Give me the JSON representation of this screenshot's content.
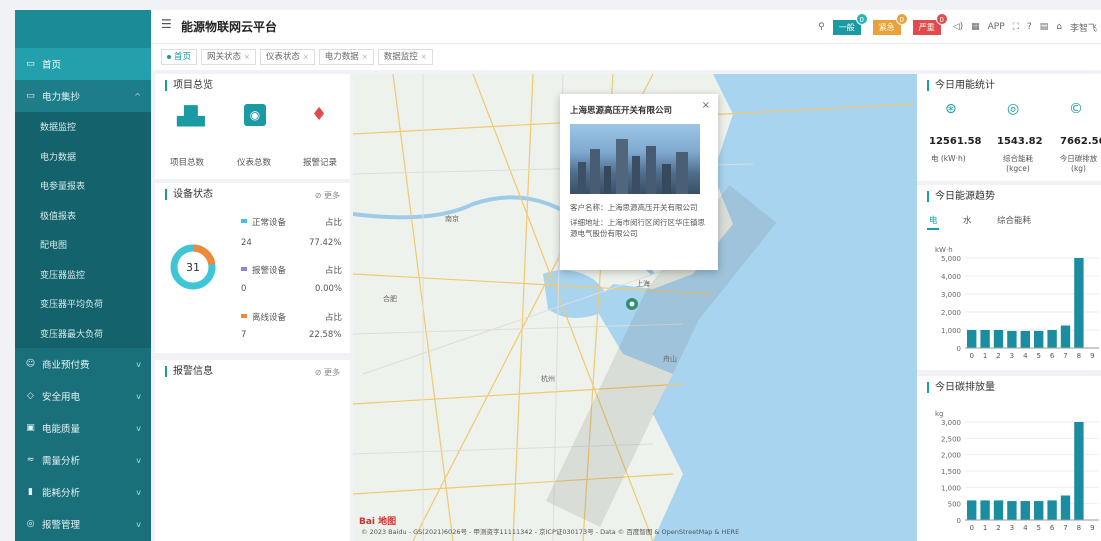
{
  "app": {
    "title": "能源物联网云平台"
  },
  "header": {
    "alarms": [
      {
        "label": "一般",
        "count": "0",
        "color": "#1a9aa3"
      },
      {
        "label": "紧急",
        "count": "0",
        "color": "#e8a23a"
      },
      {
        "label": "严重",
        "count": "0",
        "color": "#e04b4b"
      }
    ],
    "app_label": "APP",
    "user": "李智飞"
  },
  "tabs": [
    {
      "label": "首页",
      "active": true
    },
    {
      "label": "网关状态"
    },
    {
      "label": "仪表状态"
    },
    {
      "label": "电力数据"
    },
    {
      "label": "数据监控"
    }
  ],
  "sidebar": {
    "items": [
      {
        "label": "首页",
        "icon": "screen-icon",
        "active": true
      },
      {
        "label": "电力集抄",
        "icon": "monitor-icon",
        "open": true
      },
      {
        "label": "商业预付费",
        "icon": "user-icon"
      },
      {
        "label": "安全用电",
        "icon": "shield-icon"
      },
      {
        "label": "电能质量",
        "icon": "meter-icon"
      },
      {
        "label": "需量分析",
        "icon": "analysis-icon"
      },
      {
        "label": "能耗分析",
        "icon": "bar-chart-icon"
      },
      {
        "label": "报警管理",
        "icon": "alarm-icon"
      }
    ],
    "submenu": [
      "数据监控",
      "电力数据",
      "电参量报表",
      "极值报表",
      "配电图",
      "变压器监控",
      "变压器平均负荷",
      "变压器最大负荷"
    ]
  },
  "overview": {
    "title": "项目总览",
    "items": [
      {
        "label": "项目总数",
        "icon": "building-icon"
      },
      {
        "label": "仪表总数",
        "icon": "meter-icon"
      },
      {
        "label": "报警记录",
        "icon": "alarm-pin-icon"
      }
    ]
  },
  "device_status": {
    "title": "设备状态",
    "more": "更多",
    "total": "31",
    "rows": [
      {
        "name": "正常设备",
        "ratio_label": "占比",
        "count": "24",
        "ratio": "77.42%",
        "color": "#3ec6d8"
      },
      {
        "name": "报警设备",
        "ratio_label": "占比",
        "count": "0",
        "ratio": "0.00%",
        "color": "#9a7fe0"
      },
      {
        "name": "离线设备",
        "ratio_label": "占比",
        "count": "7",
        "ratio": "22.58%",
        "color": "#f0883a"
      }
    ]
  },
  "alarm_info": {
    "title": "报警信息",
    "more": "更多"
  },
  "map": {
    "popup": {
      "title": "上海思源高压开关有限公司",
      "customer": "客户名称：上海思源高压开关有限公司",
      "address": "详细地址：上海市闵行区闵行区华庄镇思源电气股份有限公司"
    },
    "cities": [
      "南京",
      "上海",
      "杭州",
      "苏州",
      "合肥",
      "舟山"
    ],
    "copyright": "© 2023 Baidu - GS(2021)6026号 - 甲测资字11111342 - 京ICP证030173号 - Data © 百度智图 & OpenStreetMap & HERE",
    "logo": "Bai 地图"
  },
  "today_stats": {
    "title": "今日用能统计",
    "items": [
      {
        "value": "12561.58",
        "label": "电 (kW·h)",
        "icon": "lightning-icon"
      },
      {
        "value": "1543.82",
        "label": "综合能耗 (kgce)",
        "icon": "signal-icon"
      },
      {
        "value": "7662.56",
        "label": "今日碳排放 (kg)",
        "icon": "carbon-icon"
      }
    ]
  },
  "energy_trend": {
    "title": "今日能源趋势",
    "tabs": [
      "电",
      "水",
      "综合能耗"
    ]
  },
  "carbon_trend": {
    "title": "今日碳排放量"
  },
  "chart_data": [
    {
      "type": "bar",
      "title": "今日能源趋势",
      "ylabel": "kW·h",
      "ylim": [
        0,
        5000
      ],
      "yticks": [
        "5,000",
        "4,000",
        "3,000",
        "2,000",
        "1,000",
        "0"
      ],
      "categories": [
        "0",
        "1",
        "2",
        "3",
        "4",
        "5",
        "6",
        "7",
        "8",
        "9"
      ],
      "values": [
        1000,
        1000,
        1000,
        950,
        950,
        950,
        1000,
        1250,
        5000,
        0
      ]
    },
    {
      "type": "bar",
      "title": "今日碳排放量",
      "ylabel": "kg",
      "ylim": [
        0,
        3000
      ],
      "yticks": [
        "3,000",
        "2,500",
        "2,000",
        "1,500",
        "1,000",
        "500",
        "0"
      ],
      "categories": [
        "0",
        "1",
        "2",
        "3",
        "4",
        "5",
        "6",
        "7",
        "8",
        "9"
      ],
      "values": [
        600,
        600,
        600,
        580,
        580,
        580,
        600,
        750,
        3000,
        0
      ]
    }
  ],
  "colors": {
    "primary": "#1a9aa3",
    "sidebar": "#1a707a",
    "bar": "#1a8ea0"
  }
}
